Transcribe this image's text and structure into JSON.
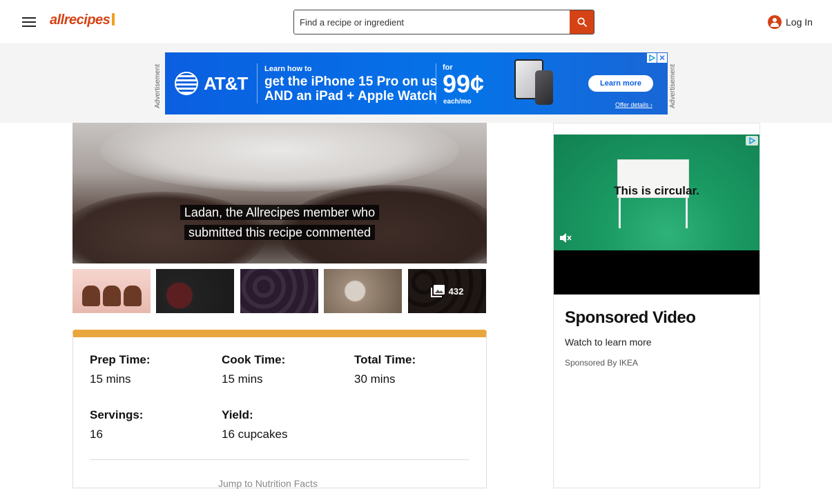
{
  "header": {
    "logo_text": "allrecipes",
    "search_placeholder": "Find a recipe or ingredient",
    "login_label": "Log In"
  },
  "top_ad": {
    "side_label": "Advertisement",
    "brand": "AT&T",
    "kicker": "Learn how to",
    "headline": "get the iPhone 15 Pro on us AND an iPad + Apple Watch",
    "for_label": "for",
    "price": "99¢",
    "price_unit": "each/mo",
    "cta": "Learn more",
    "offer_details": "Offer details ›",
    "close_icon": "✕"
  },
  "video": {
    "caption_line1": "Ladan, the Allrecipes member who",
    "caption_line2": "submitted this recipe commented"
  },
  "gallery": {
    "photo_count": "432",
    "photo_icon": "photo-library-icon"
  },
  "recipe_details": {
    "accent_color": "#e9a63d",
    "items": [
      {
        "label": "Prep Time:",
        "value": "15 mins"
      },
      {
        "label": "Cook Time:",
        "value": "15 mins"
      },
      {
        "label": "Total Time:",
        "value": "30 mins"
      },
      {
        "label": "Servings:",
        "value": "16"
      },
      {
        "label": "Yield:",
        "value": "16 cupcakes"
      }
    ],
    "faded_text": "Jump to Nutrition Facts"
  },
  "side_ad": {
    "video_tagline": "This is circular.",
    "title": "Sponsored Video",
    "cta": "Watch to learn more",
    "sponsor": "Sponsored By IKEA"
  },
  "colors": {
    "brand": "#d54215",
    "att_blue": "#0a5fe0",
    "ikea_green": "#1a9a63"
  }
}
